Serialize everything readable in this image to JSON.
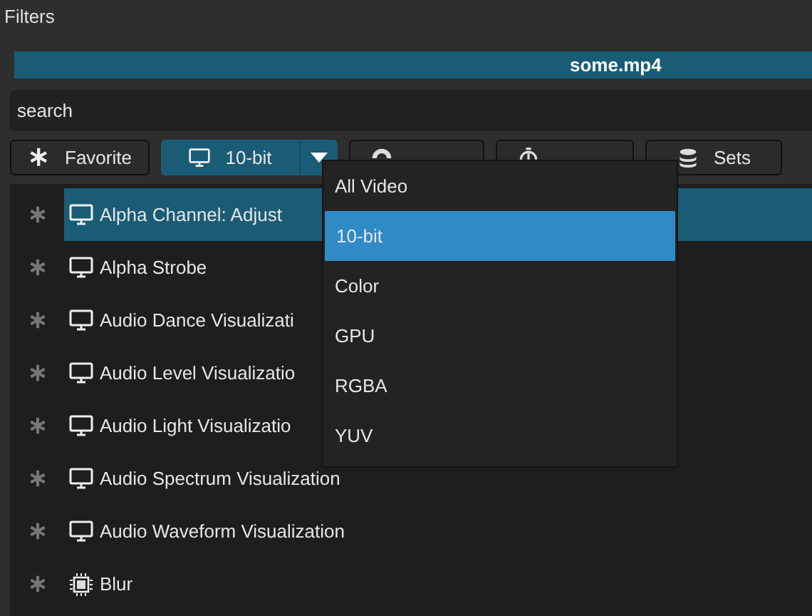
{
  "panel": {
    "title": "Filters"
  },
  "clip_bar": {
    "label": "some.mp4"
  },
  "search": {
    "placeholder": "search"
  },
  "category_buttons": [
    {
      "label": "Favorite",
      "kind": "favorite",
      "selected": false
    },
    {
      "label": "10-bit",
      "kind": "video",
      "selected": true,
      "has_menu": true
    },
    {
      "kind": "audio",
      "selected": false
    },
    {
      "kind": "time",
      "selected": false
    },
    {
      "label": "Sets",
      "kind": "sets",
      "selected": false
    }
  ],
  "filters": [
    {
      "label": "Alpha Channel: Adjust",
      "kind": "video",
      "selected": true
    },
    {
      "label": "Alpha Strobe",
      "kind": "video",
      "selected": false
    },
    {
      "label": "Audio Dance Visualizati",
      "kind": "video",
      "selected": false
    },
    {
      "label": "Audio Level Visualizatio",
      "kind": "video",
      "selected": false
    },
    {
      "label": "Audio Light Visualizatio",
      "kind": "video",
      "selected": false
    },
    {
      "label": "Audio Spectrum Visualization",
      "kind": "video",
      "selected": false
    },
    {
      "label": "Audio Waveform Visualization",
      "kind": "video",
      "selected": false
    },
    {
      "label": "Blur",
      "kind": "gpu",
      "selected": false
    }
  ],
  "video_menu": [
    {
      "label": "All Video",
      "selected": false
    },
    {
      "label": "10-bit",
      "selected": true
    },
    {
      "label": "Color",
      "selected": false
    },
    {
      "label": "GPU",
      "selected": false
    },
    {
      "label": "RGBA",
      "selected": false
    },
    {
      "label": "YUV",
      "selected": false
    }
  ]
}
